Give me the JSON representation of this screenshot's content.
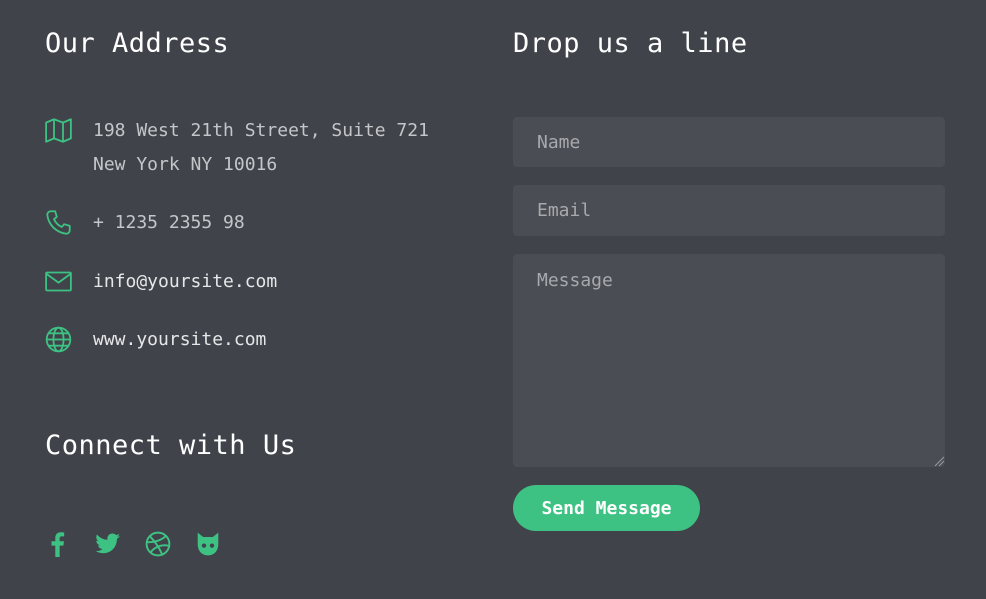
{
  "accent_color": "#3ec283",
  "background_color": "#40434a",
  "address_section": {
    "title": "Our Address",
    "items": [
      {
        "icon": "map-icon",
        "lines": [
          "198 West 21th Street, Suite 721",
          "New York NY 10016"
        ]
      },
      {
        "icon": "phone-icon",
        "lines": [
          "+ 1235 2355 98"
        ]
      },
      {
        "icon": "mail-icon",
        "lines": [
          "info@yoursite.com"
        ]
      },
      {
        "icon": "globe-icon",
        "lines": [
          "www.yoursite.com"
        ]
      }
    ]
  },
  "connect_section": {
    "title": "Connect with Us",
    "socials": [
      "facebook-icon",
      "twitter-icon",
      "dribbble-icon",
      "github-icon"
    ]
  },
  "contact_form": {
    "title": "Drop us a line",
    "name_placeholder": "Name",
    "email_placeholder": "Email",
    "message_placeholder": "Message",
    "submit_label": "Send Message"
  }
}
